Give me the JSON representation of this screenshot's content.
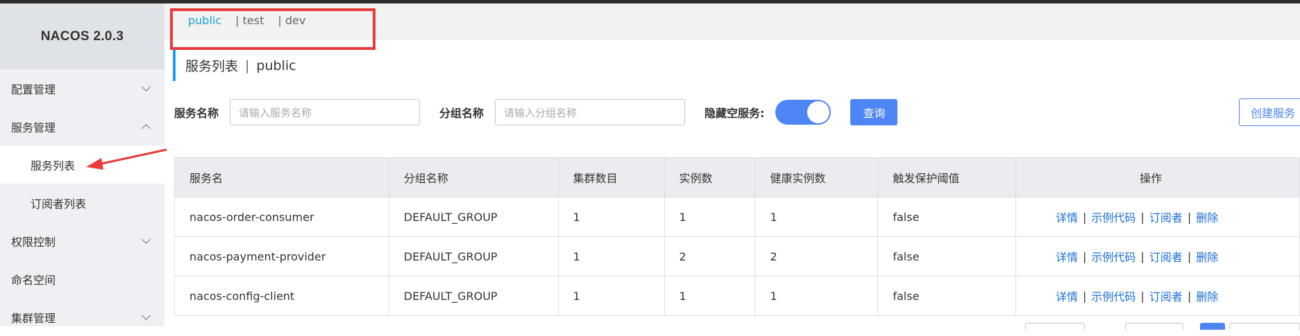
{
  "app": {
    "brand": "NACOS 2.0.3"
  },
  "sidebar": {
    "items": [
      {
        "label": "配置管理",
        "chevron": "down",
        "active": false,
        "sub": false
      },
      {
        "label": "服务管理",
        "chevron": "up",
        "active": false,
        "sub": false
      },
      {
        "label": "服务列表",
        "chevron": null,
        "active": true,
        "sub": true
      },
      {
        "label": "订阅者列表",
        "chevron": null,
        "active": false,
        "sub": true
      },
      {
        "label": "权限控制",
        "chevron": "down",
        "active": false,
        "sub": false
      },
      {
        "label": "命名空间",
        "chevron": null,
        "active": false,
        "sub": false
      },
      {
        "label": "集群管理",
        "chevron": "down",
        "active": false,
        "sub": false
      }
    ]
  },
  "namespaces": {
    "items": [
      "public",
      "| test",
      "| dev"
    ],
    "active": "public"
  },
  "page": {
    "title": "服务列表",
    "separator": "|",
    "namespace": "public"
  },
  "filters": {
    "service_name_label": "服务名称",
    "service_name_placeholder": "请输入服务名称",
    "group_name_label": "分组名称",
    "group_name_placeholder": "请输入分组名称",
    "hide_empty_label": "隐藏空服务:",
    "hide_empty_on": true,
    "query_button": "查询",
    "create_button": "创建服务"
  },
  "table": {
    "columns": [
      "服务名",
      "分组名称",
      "集群数目",
      "实例数",
      "健康实例数",
      "触发保护阈值",
      "操作"
    ],
    "rows": [
      {
        "name": "nacos-order-consumer",
        "group": "DEFAULT_GROUP",
        "clusters": "1",
        "instances": "1",
        "healthy": "1",
        "threshold": "false"
      },
      {
        "name": "nacos-payment-provider",
        "group": "DEFAULT_GROUP",
        "clusters": "1",
        "instances": "2",
        "healthy": "2",
        "threshold": "false"
      },
      {
        "name": "nacos-config-client",
        "group": "DEFAULT_GROUP",
        "clusters": "1",
        "instances": "1",
        "healthy": "1",
        "threshold": "false"
      }
    ],
    "actions": [
      "详情",
      "示例代码",
      "订阅者",
      "删除"
    ],
    "action_separator": "|"
  },
  "colors": {
    "accent": "#4e85f5",
    "link": "#1a6ed8",
    "namespace_active": "#1aa3d9",
    "annotation_red": "#e83a3a",
    "header_bar": "#209bfa"
  }
}
